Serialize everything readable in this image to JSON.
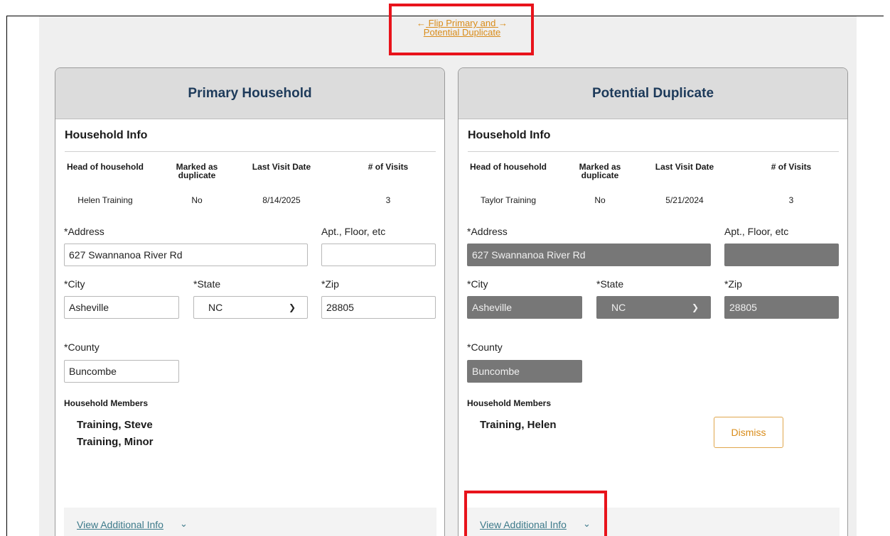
{
  "flip_link": {
    "arrow_left": "←",
    "line1": "Flip Primary and",
    "arrow_right": "→",
    "line2": "Potential Duplicate"
  },
  "primary": {
    "title": "Primary Household",
    "section_title": "Household Info",
    "columns": [
      "Head of household",
      "Marked as duplicate",
      "Last Visit Date",
      "# of Visits"
    ],
    "values": [
      "Helen Training",
      "No",
      "8/14/2025",
      "3"
    ],
    "address_label": "*Address",
    "address_value": "627 Swannanoa River Rd",
    "apt_label": "Apt., Floor, etc",
    "apt_value": "",
    "city_label": "*City",
    "city_value": "Asheville",
    "state_label": "*State",
    "state_value": "NC",
    "zip_label": "*Zip",
    "zip_value": "28805",
    "county_label": "*County",
    "county_value": "Buncombe",
    "members_label": "Household Members",
    "members": [
      "Training, Steve",
      "Training, Minor"
    ],
    "additional_info": "View Additional Info"
  },
  "duplicate": {
    "title": "Potential Duplicate",
    "section_title": "Household Info",
    "columns": [
      "Head of household",
      "Marked as duplicate",
      "Last Visit Date",
      "# of Visits"
    ],
    "values": [
      "Taylor Training",
      "No",
      "5/21/2024",
      "3"
    ],
    "address_label": "*Address",
    "address_value": "627 Swannanoa River Rd",
    "apt_label": "Apt., Floor, etc",
    "apt_value": "",
    "city_label": "*City",
    "city_value": "Asheville",
    "state_label": "*State",
    "state_value": "NC",
    "zip_label": "*Zip",
    "zip_value": "28805",
    "county_label": "*County",
    "county_value": "Buncombe",
    "members_label": "Household Members",
    "members": [
      "Training, Helen"
    ],
    "dismiss_label": "Dismiss",
    "additional_info": "View Additional Info"
  },
  "colors": {
    "accent_orange": "#d98c1a",
    "heading_navy": "#1d3a5a",
    "link_teal": "#3d7a8a",
    "annotation_red": "#e8131b",
    "disabled_field": "#777777"
  }
}
